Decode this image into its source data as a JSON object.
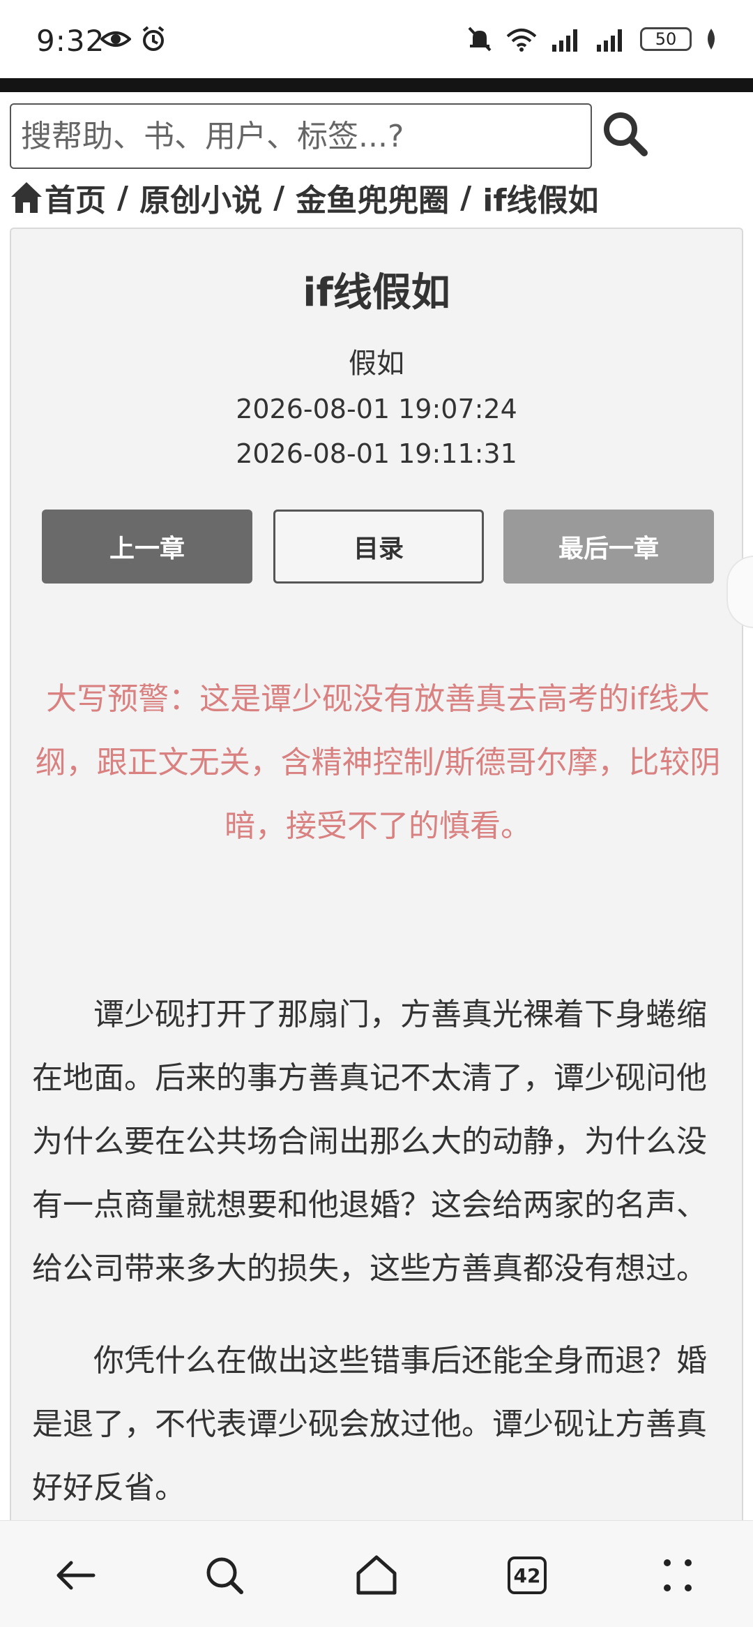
{
  "status_bar": {
    "time": "9:32",
    "battery": "50"
  },
  "search": {
    "placeholder": "搜帮助、书、用户、标签...?"
  },
  "breadcrumb": {
    "items": [
      "首页",
      "原创小说",
      "金鱼兜兜圈",
      "if线假如"
    ],
    "separator": "/"
  },
  "chapter": {
    "title": "if线假如",
    "author": "假如",
    "created": "2026-08-01 19:07:24",
    "updated": "2026-08-01 19:11:31"
  },
  "nav_buttons": {
    "prev": "上一章",
    "toc": "目录",
    "last": "最后一章"
  },
  "content": {
    "warning": "大写预警：这是谭少砚没有放善真去高考的if线大纲，跟正文无关，含精神控制/斯德哥尔摩，比较阴暗，接受不了的慎看。",
    "paragraphs": [
      "谭少砚打开了那扇门，方善真光裸着下身蜷缩在地面。后来的事方善真记不太清了，谭少砚问他为什么要在公共场合闹出那么大的动静，为什么没有一点商量就想要和他退婚？这会给两家的名声、给公司带来多大的损失，这些方善真都没有想过。",
      "你凭什么在做出这些错事后还能全身而退？婚是退了，不代表谭少砚会放过他。谭少砚让方善真好好反省。"
    ]
  },
  "bottom_nav": {
    "tab_count": "42"
  },
  "colors": {
    "warning_text": "#d98080",
    "prev_button": "#6a6a6a",
    "last_button": "#9a9a9a",
    "card_bg": "#f3f3f3"
  }
}
